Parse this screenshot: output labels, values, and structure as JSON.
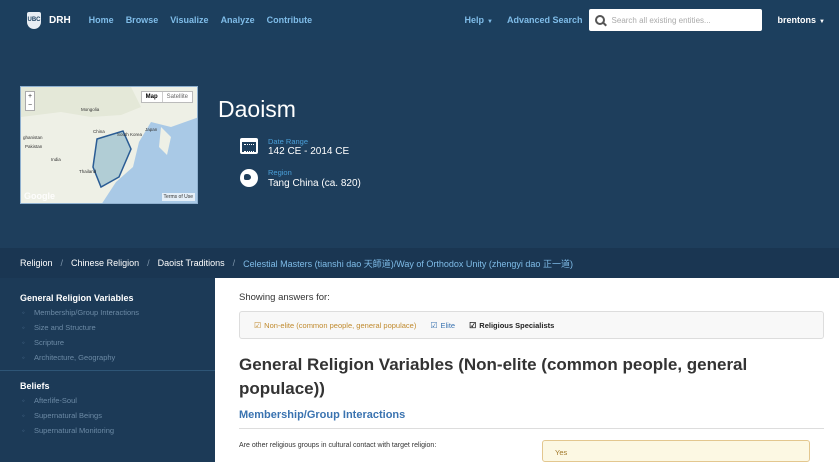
{
  "navbar": {
    "logo_text": "UBC",
    "brand": "DRH",
    "links": [
      "Home",
      "Browse",
      "Visualize",
      "Analyze",
      "Contribute"
    ],
    "help": "Help",
    "advanced_search": "Advanced Search",
    "search_placeholder": "Search all existing entities...",
    "user": "brentons"
  },
  "map": {
    "toggle_map": "Map",
    "toggle_satellite": "Satellite",
    "zoom_in": "+",
    "zoom_out": "−",
    "labels": [
      "Mongolia",
      "China",
      "South Korea",
      "Japan",
      "Pakistan",
      "India",
      "Thailand",
      "ghanistan"
    ],
    "terms": "Terms of Use",
    "google": "Google"
  },
  "entry": {
    "title": "Daoism",
    "date_label": "Date Range",
    "date_value": "142 CE - 2014 CE",
    "region_label": "Region",
    "region_value": "Tang China (ca. 820)"
  },
  "breadcrumb": {
    "items": [
      "Religion",
      "Chinese Religion",
      "Daoist Traditions"
    ],
    "current": "Celestial Masters (tianshi dao 天師道)/Way of Orthodox Unity (zhengyi dao 正一道)"
  },
  "sidebar": {
    "groups": [
      {
        "heading": "General Religion Variables",
        "items": [
          "Membership/Group Interactions",
          "Size and Structure",
          "Scripture",
          "Architecture, Geography"
        ]
      },
      {
        "heading": "Beliefs",
        "items": [
          "Afterlife-Soul",
          "Supernatural Beings",
          "Supernatural Monitoring"
        ]
      }
    ]
  },
  "main": {
    "showing_label": "Showing answers for:",
    "filters": [
      "Non-elite (common people, general populace)",
      "Elite",
      "Religious Specialists"
    ],
    "section_title": "General Religion Variables (Non-elite (common people, general populace))",
    "subsection": "Membership/Group Interactions",
    "question": "Are other religious groups in cultural contact with target religion:",
    "answer": "Yes"
  },
  "colors": {
    "navbar_bg": "#1c3f5e",
    "hero_bg": "#1e3e5c",
    "sidebar_bg": "#1c3a57",
    "link": "#7fbce8",
    "accent_blue": "#3a73b0",
    "answer_gold": "#a27a2c"
  }
}
